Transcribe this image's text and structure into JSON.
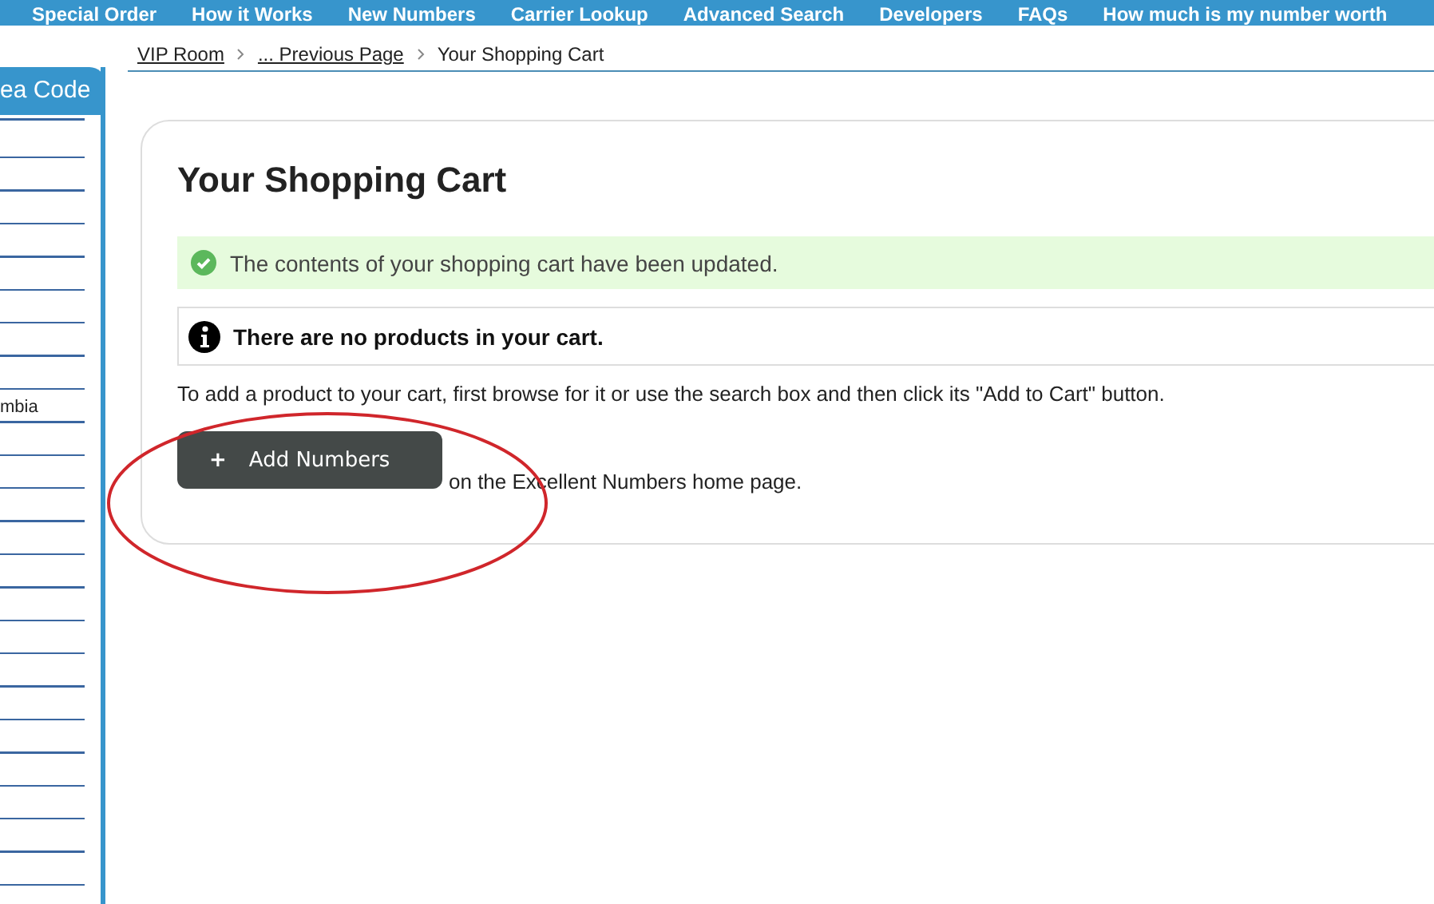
{
  "nav": [
    "Special Order",
    "How it Works",
    "New Numbers",
    "Carrier Lookup",
    "Advanced Search",
    "Developers",
    "FAQs",
    "How much is my number worth"
  ],
  "sidebar": {
    "heading": "ea Code",
    "items": [
      "mbia"
    ]
  },
  "breadcrumb": [
    "VIP Room",
    "... Previous Page",
    "Your Shopping Cart"
  ],
  "cart": {
    "title": "Your Shopping Cart",
    "success_message": "The contents of your shopping cart have been updated.",
    "info_message": "There are no products in your cart.",
    "instructions": "To add a product to your cart, first browse for it or use the search box and then click its \"Add to Cart\" button.",
    "button": {
      "icon": "+",
      "label": "Add Numbers"
    },
    "after_button": "on the Excellent Numbers home page."
  }
}
